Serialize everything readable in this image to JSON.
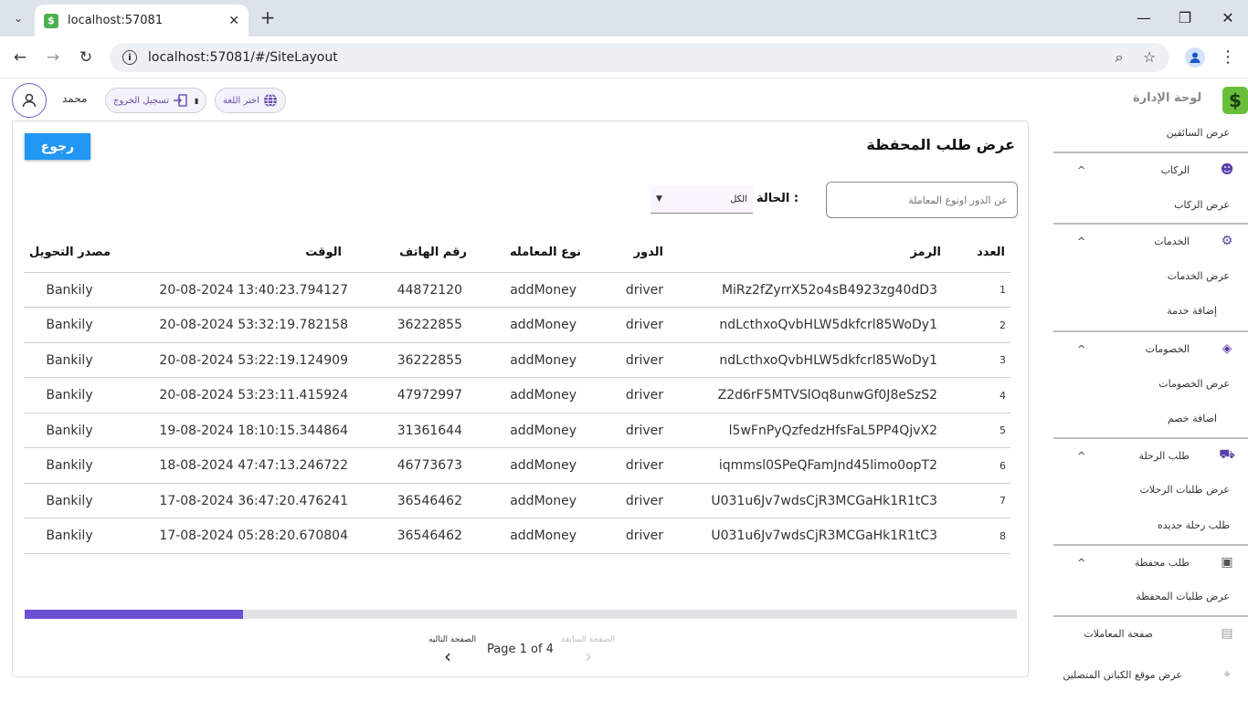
{
  "browser": {
    "tab_title": "localhost:57081",
    "tab_favicon": "$",
    "url": "localhost:57081/#/SiteLayout"
  },
  "header": {
    "user_name": "محمد",
    "logout_label": "تسجيل الخروج",
    "language_label": "اختر اللغة",
    "brand_title": "لوحة الإدارة",
    "brand_logo": "$"
  },
  "sidebar": {
    "drivers_view": "عرض السائقين",
    "riders_group": "الركاب",
    "riders_view": "عرض الركاب",
    "services_group": "الخدمات",
    "services_view": "عرض الخدمات",
    "services_add": "إضافة خدمة",
    "discounts_group": "الخصومات",
    "discounts_view": "عرض الخصومات",
    "discounts_add": "اضافة خصم",
    "trips_group": "طلب الرحلة",
    "trips_view": "عرض طلبات الرحلات",
    "trips_new": "طلب رحلة جديده",
    "wallet_group": "طلب محفظة",
    "wallet_view": "عرض طلبات المحفظة",
    "transactions_page": "صفحة المعاملات",
    "captains_location": "عرض موقع الكباتن المتصلين"
  },
  "main": {
    "title": "عرض طلب المحفظة",
    "back_button": "رجوع",
    "search_placeholder": "عن الدور اونوع المعاملة",
    "status_label": "الحالة :",
    "status_value": "الكل",
    "columns": {
      "index": "العدد",
      "code": "الرمز",
      "role": "الدور",
      "type": "نوع المعامله",
      "phone": "رقم الهاتف",
      "time": "الوقت",
      "source": "مصدر التحويل"
    },
    "rows": [
      {
        "index": "1",
        "code": "MiRz2fZyrrX52o4sB4923zg40dD3",
        "role": "driver",
        "type": "addMoney",
        "phone": "44872120",
        "time": "20-08-2024 13:40:23.794127",
        "source": "Bankily"
      },
      {
        "index": "2",
        "code": "ndLcthxoQvbHLW5dkfcrl85WoDy1",
        "role": "driver",
        "type": "addMoney",
        "phone": "36222855",
        "time": "20-08-2024 53:32:19.782158",
        "source": "Bankily"
      },
      {
        "index": "3",
        "code": "ndLcthxoQvbHLW5dkfcrl85WoDy1",
        "role": "driver",
        "type": "addMoney",
        "phone": "36222855",
        "time": "20-08-2024 53:22:19.124909",
        "source": "Bankily"
      },
      {
        "index": "4",
        "code": "Z2d6rF5MTVSlOq8unwGf0J8eSzS2",
        "role": "driver",
        "type": "addMoney",
        "phone": "47972997",
        "time": "20-08-2024 53:23:11.415924",
        "source": "Bankily"
      },
      {
        "index": "5",
        "code": "l5wFnPyQzfedzHfsFaL5PP4QjvX2",
        "role": "driver",
        "type": "addMoney",
        "phone": "31361644",
        "time": "19-08-2024 18:10:15.344864",
        "source": "Bankily"
      },
      {
        "index": "6",
        "code": "iqmmsl0SPeQFamJnd45limo0opT2",
        "role": "driver",
        "type": "addMoney",
        "phone": "46773673",
        "time": "18-08-2024 47:47:13.246722",
        "source": "Bankily"
      },
      {
        "index": "7",
        "code": "U031u6Jv7wdsCjR3MCGaHk1R1tC3",
        "role": "driver",
        "type": "addMoney",
        "phone": "36546462",
        "time": "17-08-2024 36:47:20.476241",
        "source": "Bankily"
      },
      {
        "index": "8",
        "code": "U031u6Jv7wdsCjR3MCGaHk1R1tC3",
        "role": "driver",
        "type": "addMoney",
        "phone": "36546462",
        "time": "17-08-2024 05:28:20.670804",
        "source": "Bankily"
      }
    ],
    "scroll_progress": 0.22,
    "pager": {
      "next_label": "الصفحة التاليه",
      "prev_label": "الصفحة السابقة",
      "page_text": "Page 1 of 4"
    }
  },
  "colors": {
    "accent": "#6b4fd4",
    "back_button": "#2196f3",
    "brand": "#6abf3a"
  }
}
